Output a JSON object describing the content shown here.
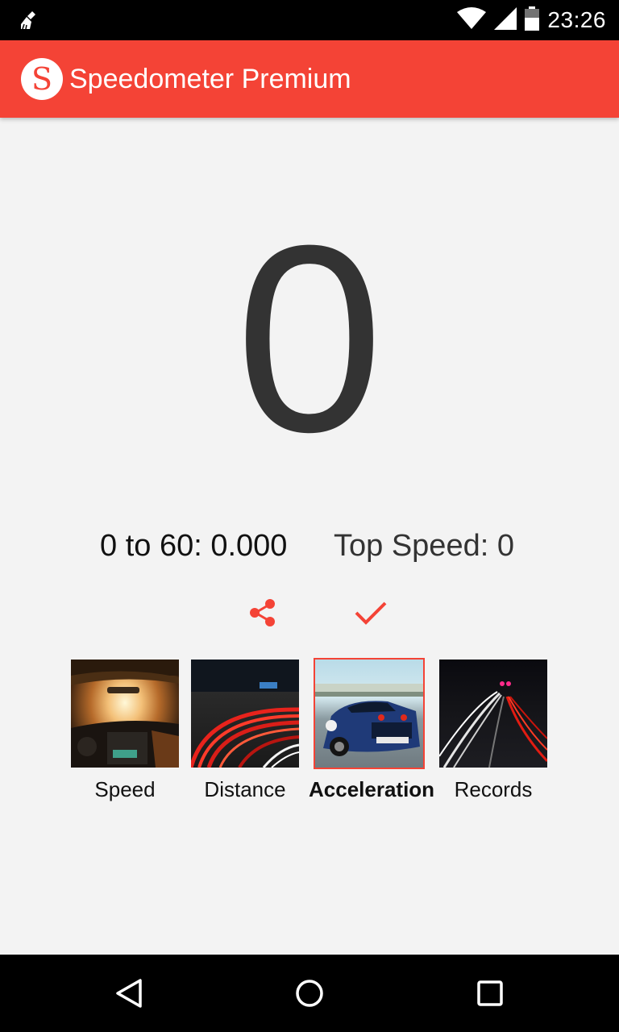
{
  "status_bar": {
    "time": "23:26",
    "icons": [
      "cleaner-icon",
      "wifi-icon",
      "signal-icon",
      "battery-icon"
    ]
  },
  "app_bar": {
    "logo_letter": "S",
    "title": "Speedometer Premium",
    "color": "#f44336"
  },
  "display": {
    "value": "0"
  },
  "stats": {
    "zero_to_sixty": "0 to 60: 0.000",
    "top_speed": "Top Speed: 0"
  },
  "actions": {
    "share_icon": "share-icon",
    "check_icon": "check-icon"
  },
  "modes": [
    {
      "label": "Speed",
      "selected": false
    },
    {
      "label": "Distance",
      "selected": false
    },
    {
      "label": "Acceleration",
      "selected": true
    },
    {
      "label": "Records",
      "selected": false
    }
  ],
  "nav_bar": {
    "buttons": [
      "back-icon",
      "home-icon",
      "recents-icon"
    ]
  }
}
